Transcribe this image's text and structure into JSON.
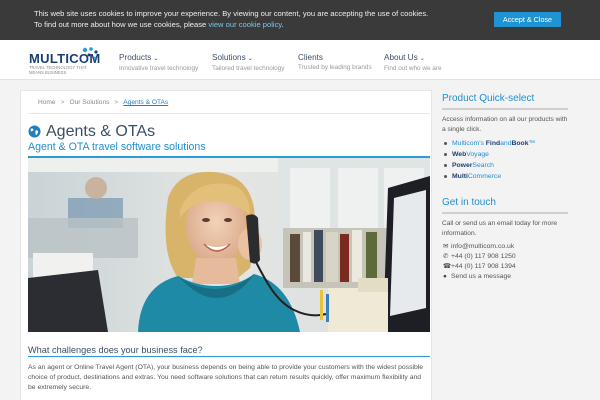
{
  "cookie": {
    "text": "This web site uses cookies to improve your experience. By viewing our content, you are accepting the use of cookies. To find out more about how we use cookies, please ",
    "link": "view our cookie policy",
    "end": ".",
    "button": "Accept & Close"
  },
  "logo": {
    "word": "MULTICOM",
    "tagline": "TRAVEL TECHNOLOGY THAT MEANS BUSINESS"
  },
  "nav": [
    {
      "title": "Products",
      "sub": "Innovative travel technology",
      "has_dropdown": true
    },
    {
      "title": "Solutions",
      "sub": "Tailored travel technology",
      "has_dropdown": true
    },
    {
      "title": "Clients",
      "sub": "Trusted by leading brands",
      "has_dropdown": false
    },
    {
      "title": "About Us",
      "sub": "Find out who we are",
      "has_dropdown": true
    }
  ],
  "breadcrumb": {
    "home": "Home",
    "solutions": "Our Solutions",
    "current": "Agents & OTAs",
    "sep": ">"
  },
  "page": {
    "title": "Agents & OTAs",
    "subtitle": "Agent & OTA travel software solutions",
    "section_heading": "What challenges does your business face?",
    "paragraph": "As an agent or Online Travel Agent (OTA), your business depends on being able to provide your customers with the widest possible choice of product, destinations and extras. You need software solutions that can return results quickly, offer maximum flexibility and be extremely secure."
  },
  "sidebar": {
    "quick_title": "Product Quick-select",
    "quick_text": "Access information on all our products with a single click.",
    "products": [
      {
        "a": "Multicom's ",
        "b": "Find",
        "c": "and",
        "d": "Book",
        "e": "™"
      },
      {
        "a": "",
        "b": "Web",
        "c": "Voyage",
        "d": "",
        "e": ""
      },
      {
        "a": "",
        "b": "Power",
        "c": "Search",
        "d": "",
        "e": ""
      },
      {
        "a": "",
        "b": "Multi",
        "c": "Commerce",
        "d": "",
        "e": ""
      }
    ],
    "touch_title": "Get in touch",
    "touch_text": "Call or send us an email today for more information.",
    "email": "info@multicom.co.uk",
    "phone": "+44 (0) 117 908 1250",
    "fax": "+44 (0) 117 908 1394",
    "message": "Send us a message"
  },
  "colors": {
    "accent": "#1f8fd0",
    "navy": "#1b3f74",
    "cookie_bg": "#3a3a3a",
    "button": "#1f94d2"
  }
}
